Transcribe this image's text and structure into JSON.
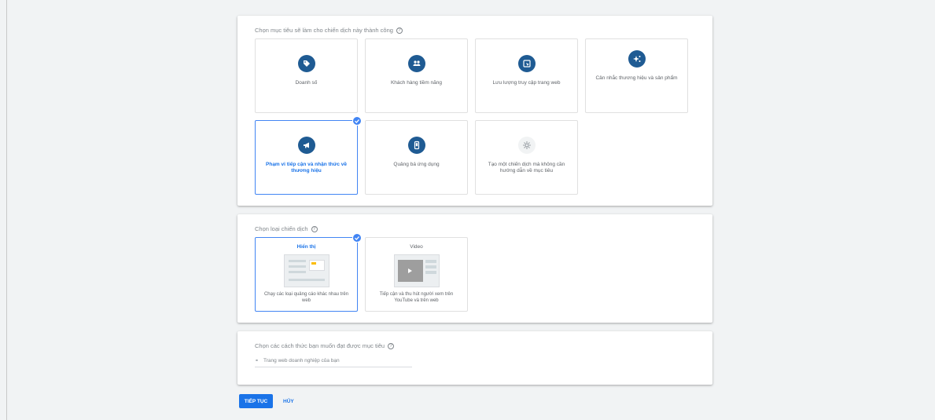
{
  "goal_section": {
    "title": "Chọn mục tiêu sẽ làm cho chiến dịch này thành công",
    "help_icon": "?",
    "cards": [
      {
        "label": "Doanh số",
        "icon": "tag-icon",
        "selected": false
      },
      {
        "label": "Khách hàng tiềm năng",
        "icon": "people-icon",
        "selected": false
      },
      {
        "label": "Lưu lượng truy cập trang web",
        "icon": "cursor-icon",
        "selected": false
      },
      {
        "label": "Cân nhắc thương hiệu và sản phẩm",
        "icon": "sparkle-icon",
        "selected": false
      },
      {
        "label": "Phạm vi tiếp cận và nhận thức về thương hiệu",
        "icon": "megaphone-icon",
        "selected": true
      },
      {
        "label": "Quảng bá ứng dụng",
        "icon": "phone-icon",
        "selected": false
      },
      {
        "label": "Tạo một chiến dịch mà không cần hướng dẫn về mục tiêu",
        "icon": "gear-icon",
        "selected": false
      }
    ]
  },
  "type_section": {
    "title": "Chọn loại chiến dịch",
    "help_icon": "?",
    "cards": [
      {
        "title": "Hiển thị",
        "desc": "Chạy các loại quảng cáo khác nhau trên web",
        "selected": true
      },
      {
        "title": "Video",
        "desc": "Tiếp cận và thu hút người xem trên YouTube và trên web",
        "selected": false
      }
    ]
  },
  "way_section": {
    "title": "Chọn các cách thức bạn muốn đạt được mục tiêu",
    "help_icon": "?",
    "url_icon": "link-icon",
    "url_placeholder": "Trang web doanh nghiệp của bạn"
  },
  "footer": {
    "continue_label": "TIẾP TỤC",
    "cancel_label": "HỦY"
  },
  "colors": {
    "accent": "#1a73e8",
    "icon_bg": "#1f5b93",
    "selected_border": "#4285f4"
  }
}
